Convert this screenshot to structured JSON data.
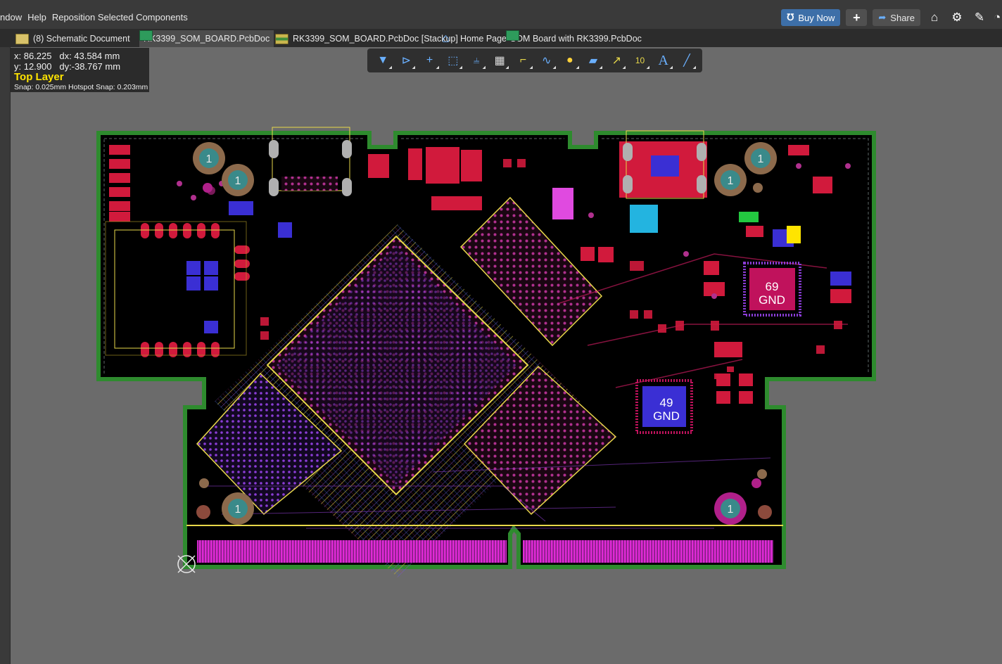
{
  "menubar": {
    "items": [
      "ndow",
      "Help",
      "Reposition Selected Components"
    ]
  },
  "titlebar_right": {
    "buy_now_label": "Buy Now",
    "share_label": "Share",
    "icons": [
      "plus-icon",
      "home-icon",
      "gear-icon",
      "edit-pen-icon",
      "account-icon"
    ]
  },
  "tabs": [
    {
      "label": "(8) Schematic Document",
      "icon": "schematic-icon",
      "dropdown": true
    },
    {
      "label": "RK3399_SOM_BOARD.PcbDoc",
      "icon": "pcb-icon",
      "active": true
    },
    {
      "label": "RK3399_SOM_BOARD.PcbDoc [Stackup]",
      "icon": "stackup-icon"
    },
    {
      "label": "Home Page",
      "icon": "home-icon"
    },
    {
      "label": "SOM Board with RK3399.PcbDoc",
      "icon": "pcb-icon"
    }
  ],
  "coords": {
    "x": "x: 86.225",
    "dx": "dx: 43.584 mm",
    "y": "y: 12.900",
    "dy": "dy:-38.767 mm",
    "layer": "Top Layer",
    "snap": "Snap: 0.025mm Hotspot Snap: 0.203mm"
  },
  "pcb_toolbar": {
    "tools": [
      "filter-icon",
      "route-selected-icon",
      "cross-icon",
      "select-area-icon",
      "align-icon",
      "component-icon",
      "route-icon",
      "diff-pair-icon",
      "via-icon",
      "polygon-icon",
      "interactive-length-icon",
      "dimension-icon",
      "string-text-icon",
      "line-icon"
    ]
  },
  "board": {
    "net_labels": [
      {
        "num": "69",
        "net": "GND"
      },
      {
        "num": "49",
        "net": "GND"
      }
    ],
    "mounting_hole_label": "1",
    "colors": {
      "board_fill": "#000000",
      "outline": "#2e8b2e",
      "top_layer": "#d11a3c",
      "bottom_layer": "#3a2fd4",
      "silk": "#e8d84a",
      "edge_fingers": "#d21fd2"
    }
  }
}
